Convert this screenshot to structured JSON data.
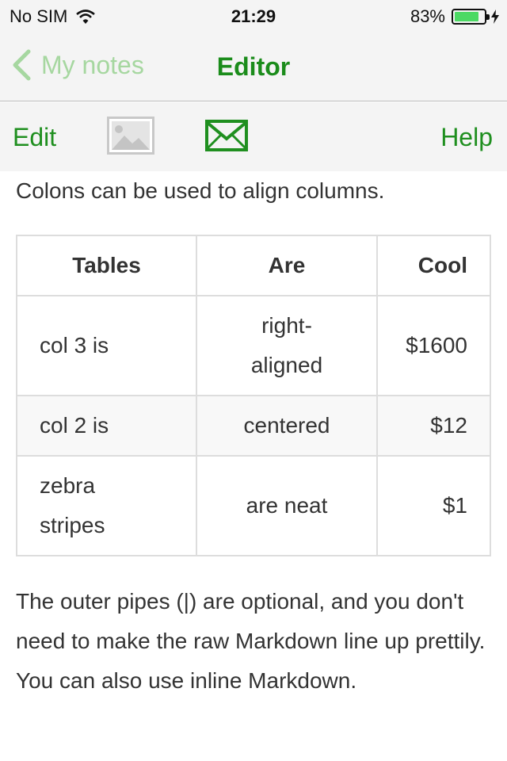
{
  "status": {
    "carrier": "No SIM",
    "time": "21:29",
    "battery_percent": "83%",
    "battery_level": 0.83,
    "battery_color": "#4cd964"
  },
  "nav": {
    "back_label": "My notes",
    "title": "Editor",
    "accent": "#1b8c1b"
  },
  "toolbar": {
    "edit_label": "Edit",
    "image_icon": "image-icon",
    "mail_icon": "mail-icon",
    "help_label": "Help"
  },
  "content": {
    "intro": "Colons can be used to align columns.",
    "table": {
      "headers": [
        "Tables",
        "Are",
        "Cool"
      ],
      "rows": [
        [
          "col 3 is",
          "right-aligned",
          "$1600"
        ],
        [
          "col 2 is",
          "centered",
          "$12"
        ],
        [
          "zebra stripes",
          "are neat",
          "$1"
        ]
      ]
    },
    "outro": "The outer pipes (|) are optional, and you don't need to make the raw Markdown line up prettily. You can also use inline Markdown."
  }
}
